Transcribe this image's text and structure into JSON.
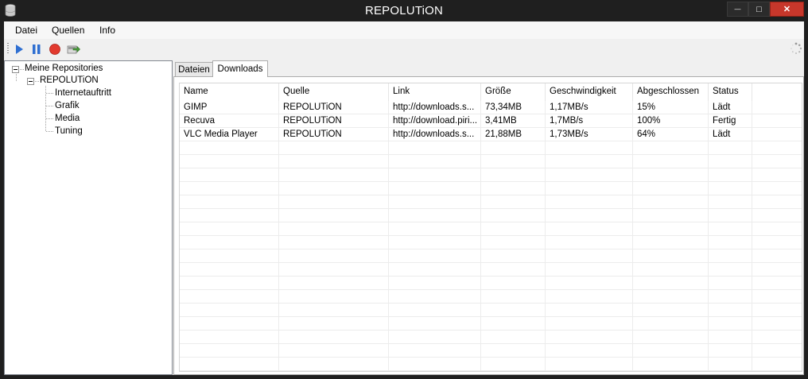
{
  "window": {
    "title": "REPOLUTiON",
    "minimize_glyph": "—",
    "maximize_glyph": "□",
    "close_glyph": "✕"
  },
  "menu": {
    "items": [
      "Datei",
      "Quellen",
      "Info"
    ]
  },
  "toolbar": {
    "buttons": [
      "play-icon",
      "pause-icon",
      "stop-icon",
      "export-icon"
    ],
    "colors": {
      "play": "#2f6fd1",
      "pause": "#2f6fd1",
      "stop": "#e23a2e",
      "export": "#4a9e3a"
    }
  },
  "tree": {
    "root": "Meine Repositories",
    "repo": "REPOLUTiON",
    "children": [
      "Internetauftritt",
      "Grafik",
      "Media",
      "Tuning"
    ]
  },
  "tabs": [
    {
      "label": "Dateien",
      "active": false
    },
    {
      "label": "Downloads",
      "active": true
    }
  ],
  "table": {
    "columns": [
      "Name",
      "Quelle",
      "Link",
      "Größe",
      "Geschwindigkeit",
      "Abgeschlossen",
      "Status"
    ],
    "rows": [
      [
        "GIMP",
        "REPOLUTiON",
        "http://downloads.s...",
        "73,34MB",
        "1,17MB/s",
        "15%",
        "Lädt"
      ],
      [
        "Recuva",
        "REPOLUTiON",
        "http://download.piri...",
        "3,41MB",
        "1,7MB/s",
        "100%",
        "Fertig"
      ],
      [
        "VLC Media Player",
        "REPOLUTiON",
        "http://downloads.s...",
        "21,88MB",
        "1,73MB/s",
        "64%",
        "Lädt"
      ]
    ]
  }
}
